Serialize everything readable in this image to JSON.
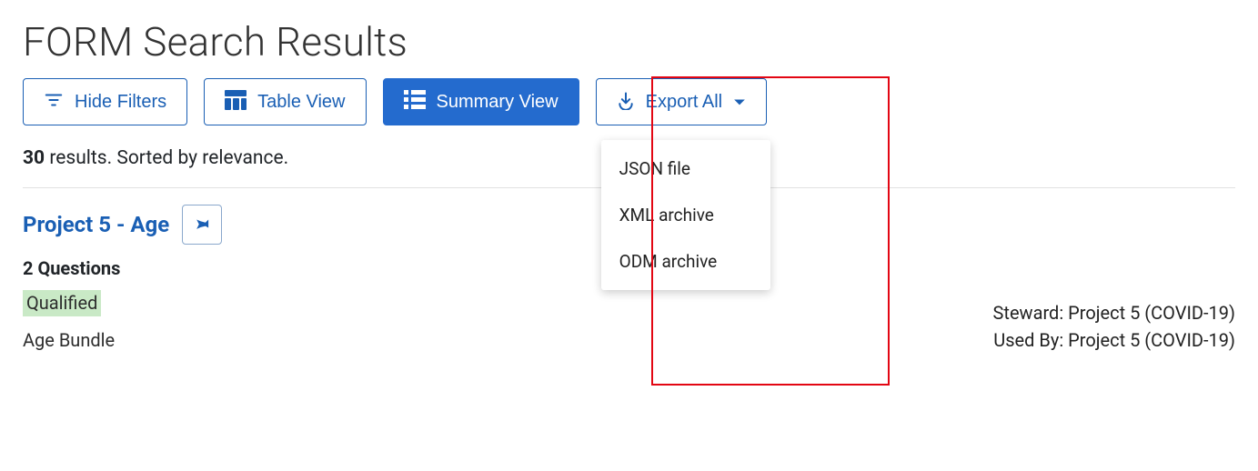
{
  "page_title": "FORM Search Results",
  "toolbar": {
    "hide_filters": "Hide Filters",
    "table_view": "Table View",
    "summary_view": "Summary View",
    "export_all": "Export All"
  },
  "export_menu": {
    "items": [
      {
        "label": "JSON file"
      },
      {
        "label": "XML archive"
      },
      {
        "label": "ODM archive"
      }
    ]
  },
  "results_meta": {
    "count": "30",
    "tail": " results. Sorted by relevance."
  },
  "result": {
    "title": "Project 5 - Age",
    "questions_label": "2 Questions",
    "status": "Qualified",
    "bundle": "Age Bundle",
    "steward": {
      "label": "Steward: ",
      "value": "Project 5 (COVID-19)"
    },
    "used_by": {
      "label": "Used By: ",
      "value": "Project 5 (COVID-19)"
    }
  }
}
